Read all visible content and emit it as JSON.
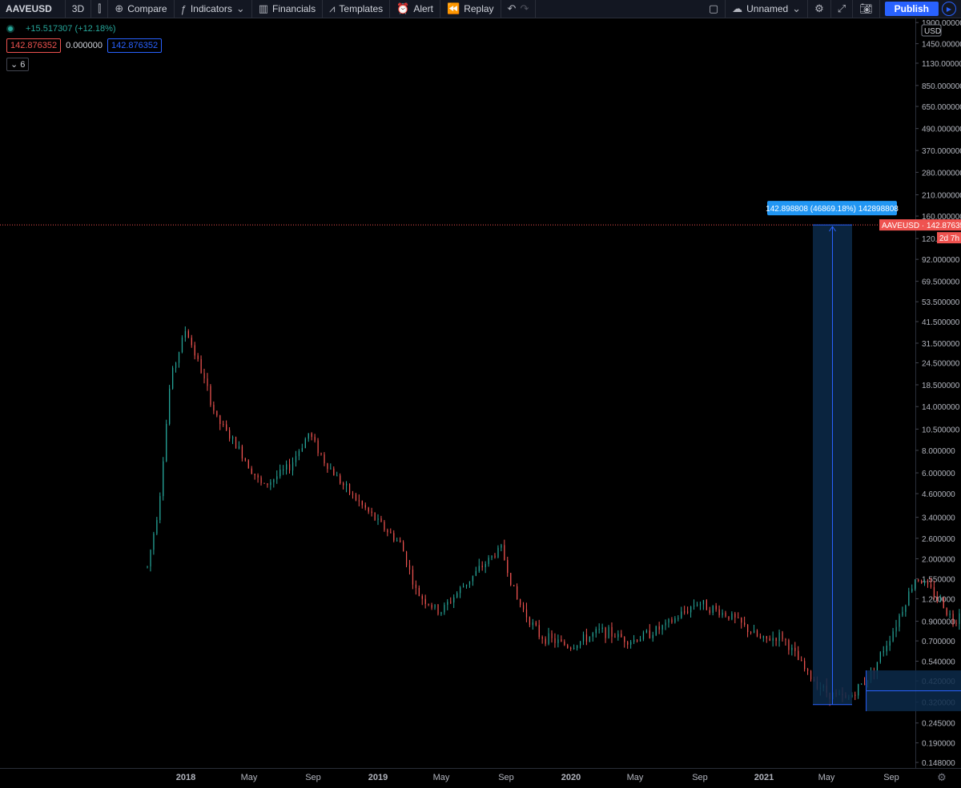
{
  "toolbar": {
    "symbol": "AAVEUSD",
    "interval": "3D",
    "compare": "Compare",
    "indicators": "Indicators",
    "financials": "Financials",
    "templates": "Templates",
    "alert": "Alert",
    "replay": "Replay",
    "layout_name": "Unnamed",
    "publish": "Publish"
  },
  "legend": {
    "change": "+15.517307 (+12.18%)",
    "bid": "142.876352",
    "spread": "0.000000",
    "ask": "142.876352",
    "indicator_count": "6"
  },
  "colors": {
    "up": "#26a69a",
    "down": "#ef5350",
    "accent": "#2962ff",
    "measure_fill": "#0c2a4a"
  },
  "chart_data": {
    "type": "candlestick",
    "symbol": "AAVEUSD",
    "scale": "log",
    "currency": "USD",
    "ylim": [
      0.14,
      1900
    ],
    "x_tick_labels": [
      "2018",
      "May",
      "Sep",
      "2019",
      "May",
      "Sep",
      "2020",
      "May",
      "Sep",
      "2021",
      "May",
      "Sep"
    ],
    "y_tick_labels": [
      "1900.000000",
      "1450.000000",
      "1130.000000",
      "850.000000",
      "650.000000",
      "490.000000",
      "370.000000",
      "280.000000",
      "210.000000",
      "160.000000",
      "120.0",
      "92.000000",
      "69.500000",
      "53.500000",
      "41.500000",
      "31.500000",
      "24.500000",
      "18.500000",
      "14.000000",
      "10.500000",
      "8.000000",
      "6.000000",
      "4.600000",
      "3.400000",
      "2.600000",
      "2.000000",
      "1.550000",
      "1.200000",
      "0.900000",
      "0.700000",
      "0.540000",
      "0.420000",
      "0.320000",
      "0.245000",
      "0.190000",
      "0.148000"
    ],
    "last_price": 142.876352,
    "price_label": "AAVEUSD · 142.876352",
    "countdown": "2d 7h",
    "price_path": [
      [
        2017.9,
        1.8
      ],
      [
        2017.93,
        4.0
      ],
      [
        2017.96,
        20
      ],
      [
        2018.0,
        38
      ],
      [
        2018.04,
        22
      ],
      [
        2018.08,
        12
      ],
      [
        2018.14,
        8
      ],
      [
        2018.2,
        5
      ],
      [
        2018.27,
        6.5
      ],
      [
        2018.32,
        10
      ],
      [
        2018.36,
        7
      ],
      [
        2018.42,
        4.8
      ],
      [
        2018.5,
        3.2
      ],
      [
        2018.56,
        2.4
      ],
      [
        2018.6,
        1.3
      ],
      [
        2018.66,
        1.0
      ],
      [
        2018.72,
        1.4
      ],
      [
        2018.78,
        1.9
      ],
      [
        2018.82,
        2.3
      ],
      [
        2018.86,
        1.2
      ],
      [
        2018.92,
        0.75
      ],
      [
        2019.0,
        0.65
      ],
      [
        2019.08,
        0.8
      ],
      [
        2019.16,
        0.7
      ],
      [
        2019.25,
        0.85
      ],
      [
        2019.33,
        1.15
      ],
      [
        2019.42,
        0.95
      ],
      [
        2019.5,
        0.7
      ],
      [
        2019.55,
        0.75
      ],
      [
        2019.62,
        0.45
      ],
      [
        2019.67,
        0.36
      ],
      [
        2019.72,
        0.33
      ],
      [
        2019.78,
        0.45
      ],
      [
        2019.84,
        0.8
      ],
      [
        2019.9,
        1.6
      ],
      [
        2019.96,
        1.2
      ],
      [
        2020.0,
        0.88
      ],
      [
        2020.05,
        1.7
      ],
      [
        2020.12,
        2.6
      ],
      [
        2020.18,
        3.6
      ],
      [
        2020.22,
        2.0
      ],
      [
        2020.27,
        1.5
      ],
      [
        2020.32,
        2.2
      ],
      [
        2020.36,
        4.0
      ],
      [
        2020.4,
        7.0
      ],
      [
        2020.44,
        6.0
      ],
      [
        2020.48,
        9.0
      ],
      [
        2020.53,
        17
      ],
      [
        2020.58,
        30
      ],
      [
        2020.62,
        55
      ],
      [
        2020.66,
        82
      ],
      [
        2020.7,
        58
      ],
      [
        2020.74,
        50
      ],
      [
        2020.78,
        40
      ],
      [
        2020.81,
        28
      ],
      [
        2020.85,
        55
      ],
      [
        2020.9,
        80
      ],
      [
        2020.95,
        95
      ],
      [
        2021.0,
        110
      ],
      [
        2021.02,
        142.876352
      ]
    ],
    "annotations": {
      "range_label": "159 bars, 476d",
      "price_range_label": "142.898808 (46869.18%) 142898808"
    }
  }
}
